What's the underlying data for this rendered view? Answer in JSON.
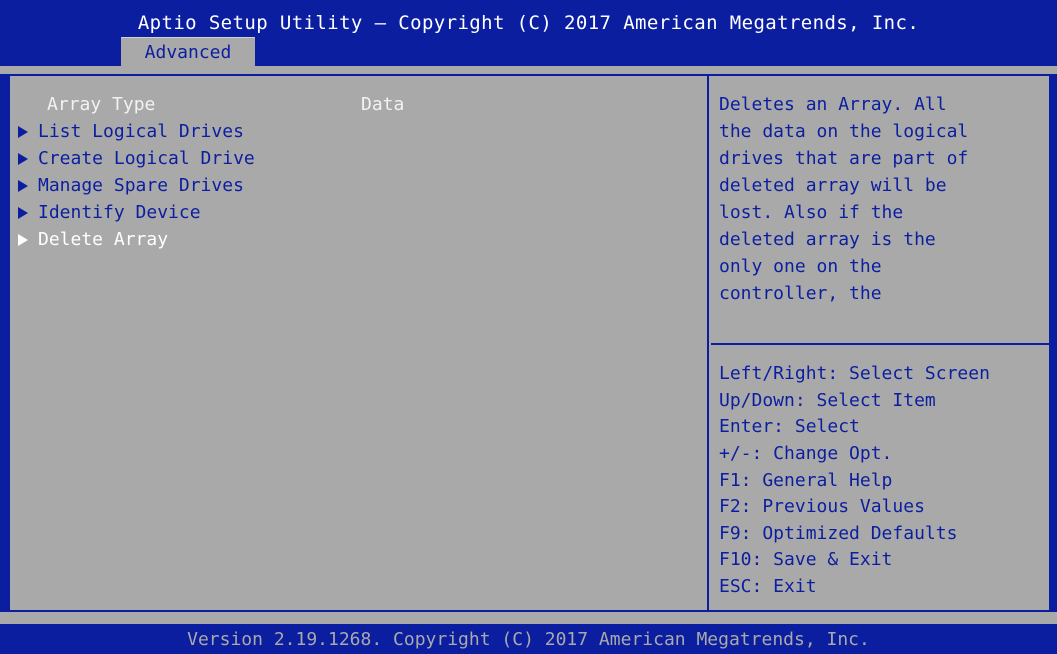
{
  "header": {
    "title": "Aptio Setup Utility – Copyright (C) 2017 American Megatrends, Inc.",
    "active_tab": "Advanced"
  },
  "main": {
    "static_row": {
      "label": "Array Type",
      "value": "Data"
    },
    "menu_items": [
      {
        "label": "List Logical Drives"
      },
      {
        "label": "Create Logical Drive"
      },
      {
        "label": "Manage Spare Drives"
      },
      {
        "label": "Identify Device"
      },
      {
        "label": "Delete Array",
        "selected": true
      }
    ]
  },
  "help": {
    "description": [
      "Deletes an Array. All",
      "the data on the logical",
      "drives that are part of",
      "deleted array will be",
      "lost. Also if the",
      "deleted array is the",
      "only one on the",
      "controller, the"
    ],
    "keys": [
      "Left/Right: Select Screen",
      "Up/Down: Select Item",
      "Enter: Select",
      "+/-: Change Opt.",
      "F1: General Help",
      "F2: Previous Values",
      "F9: Optimized Defaults",
      "F10: Save & Exit",
      "ESC: Exit"
    ]
  },
  "footer": {
    "text": "Version 2.19.1268. Copyright (C) 2017 American Megatrends, Inc."
  },
  "colors": {
    "blue": "#0b1ea0",
    "gray": "#a9a9a9",
    "white": "#ffffff"
  }
}
